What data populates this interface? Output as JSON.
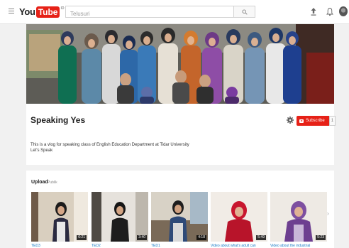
{
  "masthead": {
    "logo_you": "You",
    "logo_tube": "Tube",
    "logo_region": "ID",
    "search_placeholder": "Telusuri"
  },
  "channel": {
    "name": "Speaking Yes",
    "subscribe_label": "Subscribe",
    "subscriber_count": "1",
    "description_line1": "This is a vlog for speaking class of English Education Department at Tidar University",
    "description_line2": "Let's Speak"
  },
  "uploads": {
    "title": "Upload",
    "subtitle": "Publik",
    "videos": [
      {
        "title": "TED3",
        "duration": "6:21"
      },
      {
        "title": "TED2",
        "duration": "3:40"
      },
      {
        "title": "TED1",
        "duration": "4:18"
      },
      {
        "title": "Video about what's adult can",
        "duration": "5:49"
      },
      {
        "title": "Video about the industrial",
        "duration": "5:23"
      }
    ]
  },
  "icons": {
    "menu": "menu-icon",
    "search": "search-icon",
    "upload": "upload-icon",
    "notifications": "bell-icon",
    "settings": "gear-icon",
    "next": "chevron-right-icon"
  },
  "colors": {
    "brand_red": "#e62117",
    "link_blue": "#167ac6",
    "page_bg": "#f1f1f1"
  }
}
